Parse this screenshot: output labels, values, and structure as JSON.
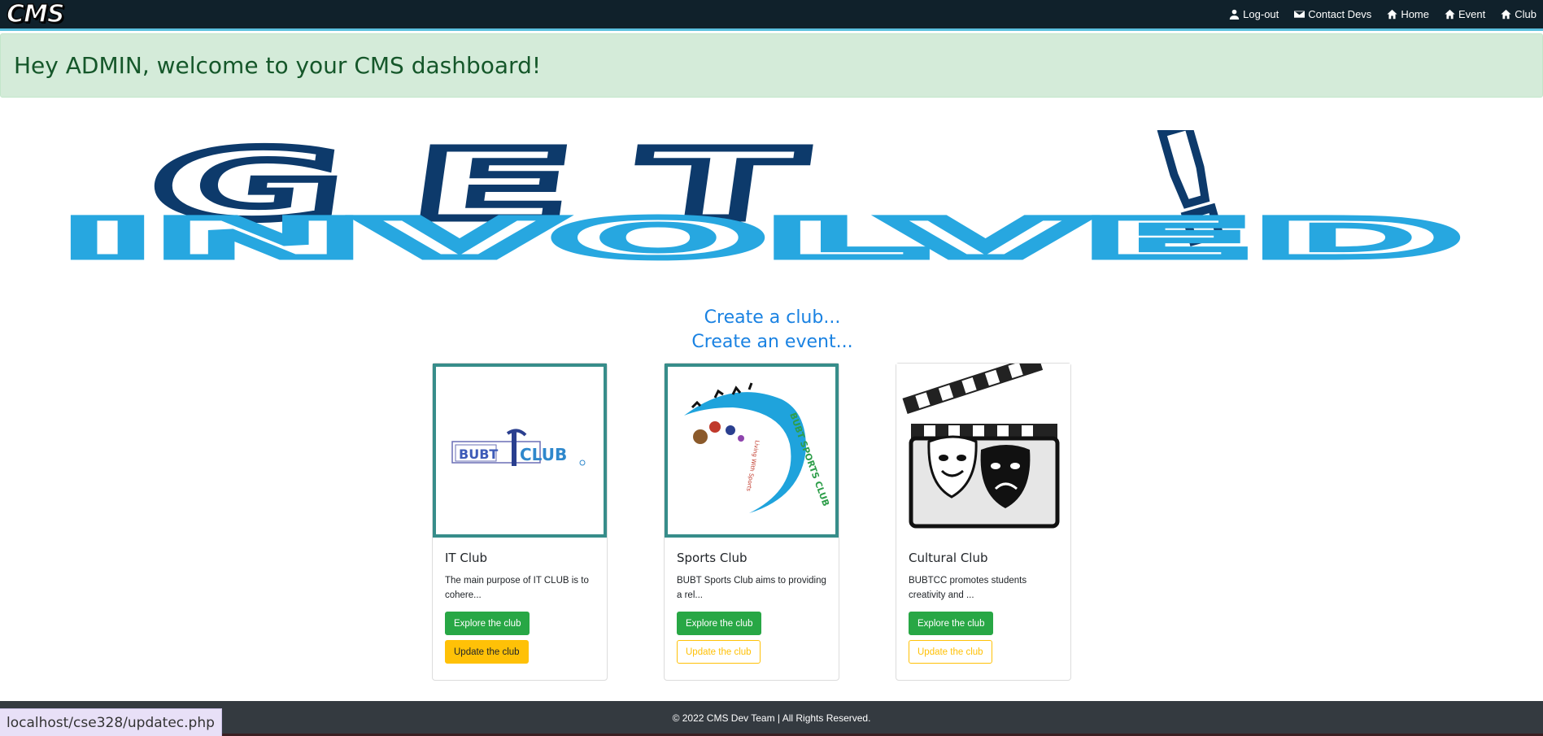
{
  "navbar": {
    "brand": "CMS",
    "links": [
      {
        "label": "Log-out",
        "icon": "user-icon"
      },
      {
        "label": "Contact Devs",
        "icon": "envelope-icon"
      },
      {
        "label": "Home",
        "icon": "home-icon"
      },
      {
        "label": "Event",
        "icon": "home-icon"
      },
      {
        "label": "Club",
        "icon": "home-icon"
      }
    ]
  },
  "alert": {
    "message": "Hey ADMIN, welcome to your CMS dashboard!"
  },
  "banner": {
    "line1": "GET",
    "line2": "INVOLVED",
    "mark": "!"
  },
  "cta": {
    "line1": "Create a club...",
    "line2": "Create an event..."
  },
  "cards": [
    {
      "title": "IT Club",
      "text": "The main purpose of IT CLUB is to cohere...",
      "explore": "Explore the club",
      "update": "Update the club",
      "logo_text_1": "BUBT",
      "logo_text_2": "CLUB"
    },
    {
      "title": "Sports Club",
      "text": "BUBT Sports Club aims to providing a rel...",
      "explore": "Explore the club",
      "update": "Update the club",
      "logo_text_1": "BUBT SPORTS CLUB",
      "logo_text_2": "Living With Sports"
    },
    {
      "title": "Cultural Club",
      "text": "BUBTCC promotes students creativity and ...",
      "explore": "Explore the club",
      "update": "Update the club"
    }
  ],
  "footer": {
    "text": "© 2022 CMS Dev Team | All Rights Reserved."
  },
  "status_bar": {
    "url": "localhost/cse328/updatec.php"
  },
  "colors": {
    "navbar": "#10212b",
    "alert_bg": "#d4ebd9",
    "alert_text": "#15572a",
    "cta": "#1a82e2",
    "explore": "#28a745",
    "update": "#ffc107",
    "card_frame": "#378d8a",
    "footer": "#343a40"
  }
}
